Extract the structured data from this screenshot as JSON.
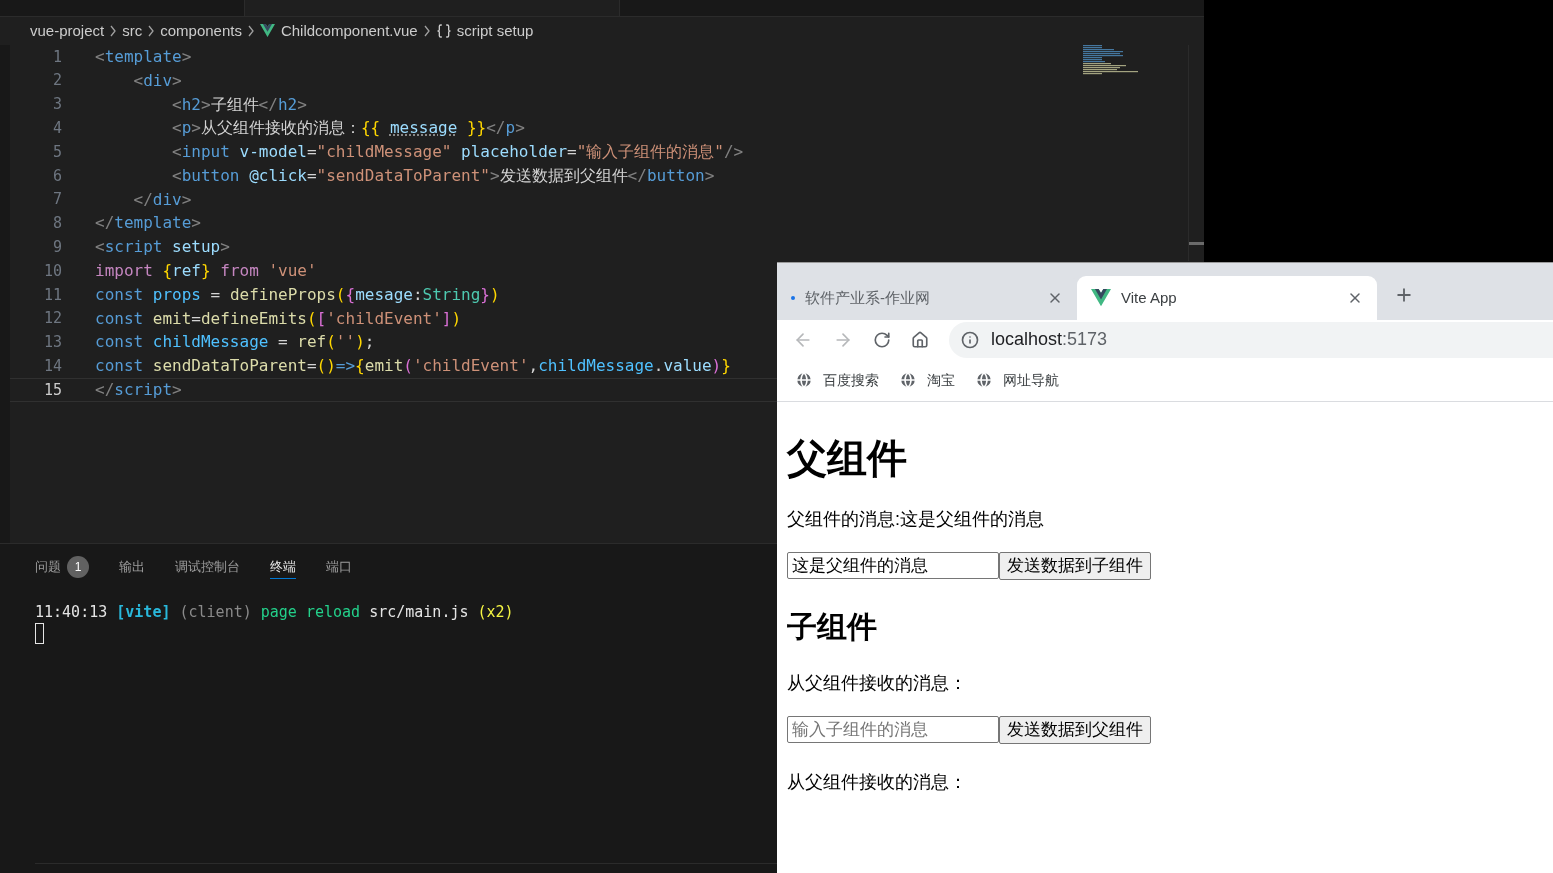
{
  "editor": {
    "breadcrumbs": [
      {
        "kind": "folder",
        "text": "vue-project"
      },
      {
        "kind": "folder",
        "text": "src"
      },
      {
        "kind": "folder",
        "text": "components"
      },
      {
        "kind": "vue-file",
        "text": "Childcomponent.vue"
      },
      {
        "kind": "symbol",
        "text": "script setup"
      }
    ],
    "code_lines": [
      {
        "number": "1",
        "active": false,
        "tokens": [
          {
            "kind": "punct",
            "text": "<"
          },
          {
            "kind": "tag",
            "text": "template"
          },
          {
            "kind": "punct",
            "text": ">"
          }
        ]
      },
      {
        "number": "2",
        "active": false,
        "tokens": [
          {
            "kind": "punct",
            "text": "    <"
          },
          {
            "kind": "tag",
            "text": "div"
          },
          {
            "kind": "punct",
            "text": ">"
          }
        ]
      },
      {
        "number": "3",
        "active": false,
        "tokens": [
          {
            "kind": "punct",
            "text": "        <"
          },
          {
            "kind": "tag",
            "text": "h2"
          },
          {
            "kind": "punct",
            "text": ">"
          },
          {
            "kind": "text",
            "text": "子组件"
          },
          {
            "kind": "punct",
            "text": "</"
          },
          {
            "kind": "tag",
            "text": "h2"
          },
          {
            "kind": "punct",
            "text": ">"
          }
        ]
      },
      {
        "number": "4",
        "active": false,
        "tokens": [
          {
            "kind": "punct",
            "text": "        <"
          },
          {
            "kind": "tag",
            "text": "p"
          },
          {
            "kind": "punct",
            "text": ">"
          },
          {
            "kind": "text",
            "text": "从父组件接收的消息："
          },
          {
            "kind": "b1",
            "text": "{{ "
          },
          {
            "kind": "warn",
            "text": "message"
          },
          {
            "kind": "b1",
            "text": " }}"
          },
          {
            "kind": "punct",
            "text": "</"
          },
          {
            "kind": "tag",
            "text": "p"
          },
          {
            "kind": "punct",
            "text": ">"
          }
        ]
      },
      {
        "number": "5",
        "active": false,
        "tokens": [
          {
            "kind": "punct",
            "text": "        <"
          },
          {
            "kind": "tag",
            "text": "input"
          },
          {
            "kind": "attr",
            "text": " v-model"
          },
          {
            "kind": "text",
            "text": "="
          },
          {
            "kind": "str",
            "text": "\"childMessage\""
          },
          {
            "kind": "attr",
            "text": " placeholder"
          },
          {
            "kind": "text",
            "text": "="
          },
          {
            "kind": "str",
            "text": "\"输入子组件的消息\""
          },
          {
            "kind": "punct",
            "text": "/>"
          }
        ]
      },
      {
        "number": "6",
        "active": false,
        "tokens": [
          {
            "kind": "punct",
            "text": "        <"
          },
          {
            "kind": "tag",
            "text": "button"
          },
          {
            "kind": "attr",
            "text": " @click"
          },
          {
            "kind": "text",
            "text": "="
          },
          {
            "kind": "str",
            "text": "\"sendDataToParent\""
          },
          {
            "kind": "punct",
            "text": ">"
          },
          {
            "kind": "text",
            "text": "发送数据到父组件"
          },
          {
            "kind": "punct",
            "text": "</"
          },
          {
            "kind": "tag",
            "text": "button"
          },
          {
            "kind": "punct",
            "text": ">"
          }
        ]
      },
      {
        "number": "7",
        "active": false,
        "tokens": [
          {
            "kind": "punct",
            "text": "    </"
          },
          {
            "kind": "tag",
            "text": "div"
          },
          {
            "kind": "punct",
            "text": ">"
          }
        ]
      },
      {
        "number": "8",
        "active": false,
        "tokens": [
          {
            "kind": "punct",
            "text": "</"
          },
          {
            "kind": "tag",
            "text": "template"
          },
          {
            "kind": "punct",
            "text": ">"
          }
        ]
      },
      {
        "number": "9",
        "active": false,
        "tokens": [
          {
            "kind": "punct",
            "text": "<"
          },
          {
            "kind": "tag",
            "text": "script"
          },
          {
            "kind": "attr",
            "text": " setup"
          },
          {
            "kind": "punct",
            "text": ">"
          }
        ]
      },
      {
        "number": "10",
        "active": false,
        "tokens": [
          {
            "kind": "ctl",
            "text": "import"
          },
          {
            "kind": "b1",
            "text": " {"
          },
          {
            "kind": "attr",
            "text": "ref"
          },
          {
            "kind": "b1",
            "text": "}"
          },
          {
            "kind": "ctl",
            "text": " from"
          },
          {
            "kind": "str",
            "text": " 'vue'"
          }
        ]
      },
      {
        "number": "11",
        "active": false,
        "tokens": [
          {
            "kind": "kw",
            "text": "const"
          },
          {
            "kind": "var",
            "text": " props"
          },
          {
            "kind": "text",
            "text": " = "
          },
          {
            "kind": "fn",
            "text": "defineProps"
          },
          {
            "kind": "b1",
            "text": "("
          },
          {
            "kind": "b2",
            "text": "{"
          },
          {
            "kind": "attr",
            "text": "mesage"
          },
          {
            "kind": "text",
            "text": ":"
          },
          {
            "kind": "type",
            "text": "String"
          },
          {
            "kind": "b2",
            "text": "}"
          },
          {
            "kind": "b1",
            "text": ")"
          }
        ]
      },
      {
        "number": "12",
        "active": false,
        "tokens": [
          {
            "kind": "kw",
            "text": "const"
          },
          {
            "kind": "fn",
            "text": " emit"
          },
          {
            "kind": "text",
            "text": "="
          },
          {
            "kind": "fn",
            "text": "defineEmits"
          },
          {
            "kind": "b1",
            "text": "("
          },
          {
            "kind": "b2",
            "text": "["
          },
          {
            "kind": "str",
            "text": "'childEvent'"
          },
          {
            "kind": "b2",
            "text": "]"
          },
          {
            "kind": "b1",
            "text": ")"
          }
        ]
      },
      {
        "number": "13",
        "active": false,
        "tokens": [
          {
            "kind": "kw",
            "text": "const"
          },
          {
            "kind": "var",
            "text": " childMessage"
          },
          {
            "kind": "text",
            "text": " = "
          },
          {
            "kind": "fn",
            "text": "ref"
          },
          {
            "kind": "b1",
            "text": "("
          },
          {
            "kind": "str",
            "text": "''"
          },
          {
            "kind": "b1",
            "text": ")"
          },
          {
            "kind": "text",
            "text": ";"
          }
        ]
      },
      {
        "number": "14",
        "active": false,
        "tokens": [
          {
            "kind": "kw",
            "text": "const"
          },
          {
            "kind": "fn",
            "text": " sendDataToParent"
          },
          {
            "kind": "text",
            "text": "="
          },
          {
            "kind": "b1",
            "text": "()"
          },
          {
            "kind": "kw",
            "text": "=>"
          },
          {
            "kind": "b1",
            "text": "{"
          },
          {
            "kind": "fn",
            "text": "emit"
          },
          {
            "kind": "b2",
            "text": "("
          },
          {
            "kind": "str",
            "text": "'childEvent'"
          },
          {
            "kind": "text",
            "text": ","
          },
          {
            "kind": "var",
            "text": "childMessage"
          },
          {
            "kind": "text",
            "text": "."
          },
          {
            "kind": "attr",
            "text": "value"
          },
          {
            "kind": "b2",
            "text": ")"
          },
          {
            "kind": "b1",
            "text": "}"
          }
        ]
      },
      {
        "number": "15",
        "active": true,
        "tokens": [
          {
            "kind": "punct",
            "text": "</"
          },
          {
            "kind": "tag",
            "text": "script"
          },
          {
            "kind": "punct",
            "text": ">"
          }
        ]
      }
    ]
  },
  "panel": {
    "tabs": [
      {
        "label": "问题",
        "badge": "1",
        "selected": false
      },
      {
        "label": "输出",
        "selected": false
      },
      {
        "label": "调试控制台",
        "selected": false
      },
      {
        "label": "终端",
        "selected": true
      },
      {
        "label": "端口",
        "selected": false
      }
    ],
    "terminal_lines": [
      {
        "tokens": [
          {
            "kind": "text",
            "text": "11:40:13"
          },
          {
            "kind": "cyan",
            "text": " [vite]"
          },
          {
            "kind": "dim",
            "text": " (client)"
          },
          {
            "kind": "green",
            "text": " page reload"
          },
          {
            "kind": "text",
            "text": " src/main.js"
          },
          {
            "kind": "yellow",
            "text": " (x2)"
          }
        ]
      }
    ]
  },
  "browser": {
    "tabs": [
      {
        "title": "软件产业系-作业网",
        "kind": "site",
        "selected": false
      },
      {
        "title": "Vite App",
        "kind": "vue",
        "selected": true
      }
    ],
    "address": {
      "host": "localhost",
      "port": ":5173"
    },
    "bookmarks": [
      "百度搜索",
      "淘宝",
      "网址导航"
    ],
    "page": [
      {
        "kind": "h1",
        "text": "父组件"
      },
      {
        "kind": "p",
        "text": "父组件的消息:这是父组件的消息"
      },
      {
        "kind": "form",
        "value": "这是父组件的消息",
        "button": "发送数据到子组件"
      },
      {
        "kind": "h2",
        "text": "子组件"
      },
      {
        "kind": "p",
        "text": "从父组件接收的消息："
      },
      {
        "kind": "form",
        "placeholder": "输入子组件的消息",
        "button": "发送数据到父组件"
      },
      {
        "kind": "p",
        "text": "从父组件接收的消息："
      }
    ]
  }
}
